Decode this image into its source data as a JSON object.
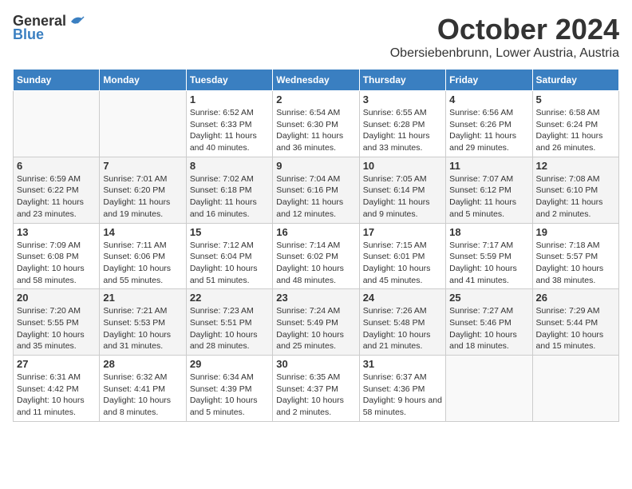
{
  "header": {
    "logo_general": "General",
    "logo_blue": "Blue",
    "month": "October 2024",
    "location": "Obersiebenbrunn, Lower Austria, Austria"
  },
  "columns": [
    "Sunday",
    "Monday",
    "Tuesday",
    "Wednesday",
    "Thursday",
    "Friday",
    "Saturday"
  ],
  "weeks": [
    [
      {
        "day": "",
        "info": ""
      },
      {
        "day": "",
        "info": ""
      },
      {
        "day": "1",
        "info": "Sunrise: 6:52 AM\nSunset: 6:33 PM\nDaylight: 11 hours and 40 minutes."
      },
      {
        "day": "2",
        "info": "Sunrise: 6:54 AM\nSunset: 6:30 PM\nDaylight: 11 hours and 36 minutes."
      },
      {
        "day": "3",
        "info": "Sunrise: 6:55 AM\nSunset: 6:28 PM\nDaylight: 11 hours and 33 minutes."
      },
      {
        "day": "4",
        "info": "Sunrise: 6:56 AM\nSunset: 6:26 PM\nDaylight: 11 hours and 29 minutes."
      },
      {
        "day": "5",
        "info": "Sunrise: 6:58 AM\nSunset: 6:24 PM\nDaylight: 11 hours and 26 minutes."
      }
    ],
    [
      {
        "day": "6",
        "info": "Sunrise: 6:59 AM\nSunset: 6:22 PM\nDaylight: 11 hours and 23 minutes."
      },
      {
        "day": "7",
        "info": "Sunrise: 7:01 AM\nSunset: 6:20 PM\nDaylight: 11 hours and 19 minutes."
      },
      {
        "day": "8",
        "info": "Sunrise: 7:02 AM\nSunset: 6:18 PM\nDaylight: 11 hours and 16 minutes."
      },
      {
        "day": "9",
        "info": "Sunrise: 7:04 AM\nSunset: 6:16 PM\nDaylight: 11 hours and 12 minutes."
      },
      {
        "day": "10",
        "info": "Sunrise: 7:05 AM\nSunset: 6:14 PM\nDaylight: 11 hours and 9 minutes."
      },
      {
        "day": "11",
        "info": "Sunrise: 7:07 AM\nSunset: 6:12 PM\nDaylight: 11 hours and 5 minutes."
      },
      {
        "day": "12",
        "info": "Sunrise: 7:08 AM\nSunset: 6:10 PM\nDaylight: 11 hours and 2 minutes."
      }
    ],
    [
      {
        "day": "13",
        "info": "Sunrise: 7:09 AM\nSunset: 6:08 PM\nDaylight: 10 hours and 58 minutes."
      },
      {
        "day": "14",
        "info": "Sunrise: 7:11 AM\nSunset: 6:06 PM\nDaylight: 10 hours and 55 minutes."
      },
      {
        "day": "15",
        "info": "Sunrise: 7:12 AM\nSunset: 6:04 PM\nDaylight: 10 hours and 51 minutes."
      },
      {
        "day": "16",
        "info": "Sunrise: 7:14 AM\nSunset: 6:02 PM\nDaylight: 10 hours and 48 minutes."
      },
      {
        "day": "17",
        "info": "Sunrise: 7:15 AM\nSunset: 6:01 PM\nDaylight: 10 hours and 45 minutes."
      },
      {
        "day": "18",
        "info": "Sunrise: 7:17 AM\nSunset: 5:59 PM\nDaylight: 10 hours and 41 minutes."
      },
      {
        "day": "19",
        "info": "Sunrise: 7:18 AM\nSunset: 5:57 PM\nDaylight: 10 hours and 38 minutes."
      }
    ],
    [
      {
        "day": "20",
        "info": "Sunrise: 7:20 AM\nSunset: 5:55 PM\nDaylight: 10 hours and 35 minutes."
      },
      {
        "day": "21",
        "info": "Sunrise: 7:21 AM\nSunset: 5:53 PM\nDaylight: 10 hours and 31 minutes."
      },
      {
        "day": "22",
        "info": "Sunrise: 7:23 AM\nSunset: 5:51 PM\nDaylight: 10 hours and 28 minutes."
      },
      {
        "day": "23",
        "info": "Sunrise: 7:24 AM\nSunset: 5:49 PM\nDaylight: 10 hours and 25 minutes."
      },
      {
        "day": "24",
        "info": "Sunrise: 7:26 AM\nSunset: 5:48 PM\nDaylight: 10 hours and 21 minutes."
      },
      {
        "day": "25",
        "info": "Sunrise: 7:27 AM\nSunset: 5:46 PM\nDaylight: 10 hours and 18 minutes."
      },
      {
        "day": "26",
        "info": "Sunrise: 7:29 AM\nSunset: 5:44 PM\nDaylight: 10 hours and 15 minutes."
      }
    ],
    [
      {
        "day": "27",
        "info": "Sunrise: 6:31 AM\nSunset: 4:42 PM\nDaylight: 10 hours and 11 minutes."
      },
      {
        "day": "28",
        "info": "Sunrise: 6:32 AM\nSunset: 4:41 PM\nDaylight: 10 hours and 8 minutes."
      },
      {
        "day": "29",
        "info": "Sunrise: 6:34 AM\nSunset: 4:39 PM\nDaylight: 10 hours and 5 minutes."
      },
      {
        "day": "30",
        "info": "Sunrise: 6:35 AM\nSunset: 4:37 PM\nDaylight: 10 hours and 2 minutes."
      },
      {
        "day": "31",
        "info": "Sunrise: 6:37 AM\nSunset: 4:36 PM\nDaylight: 9 hours and 58 minutes."
      },
      {
        "day": "",
        "info": ""
      },
      {
        "day": "",
        "info": ""
      }
    ]
  ]
}
